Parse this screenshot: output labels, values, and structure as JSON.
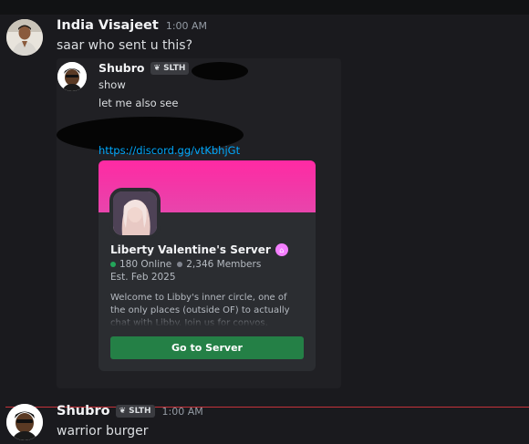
{
  "messages": [
    {
      "author": "India Visajeet",
      "time": "1:00 AM",
      "text": "saar who sent u this?",
      "forwarded": {
        "author": "Shubro",
        "tag": "SLTH",
        "lines": [
          "show",
          "let me also see"
        ],
        "link": "https://discord.gg/vtKbhjGt",
        "invite": {
          "server_name": "Liberty Valentine's Server",
          "online": "180 Online",
          "members": "2,346 Members",
          "established": "Est. Feb 2025",
          "description": "Welcome to Libby's inner circle, one of the only places (outside OF) to actually chat with Libby. Join us for convos, updates,",
          "button_label": "Go to Server",
          "banner_color": "#ff2aa3",
          "button_color": "#248046"
        }
      }
    },
    {
      "author": "Shubro",
      "tag": "SLTH",
      "time": "1:00 AM",
      "text": "warrior burger"
    }
  ],
  "colors": {
    "background": "#1a1a1e",
    "link": "#00a8fc",
    "new_divider": "#c4323a",
    "online": "#23a55a"
  }
}
